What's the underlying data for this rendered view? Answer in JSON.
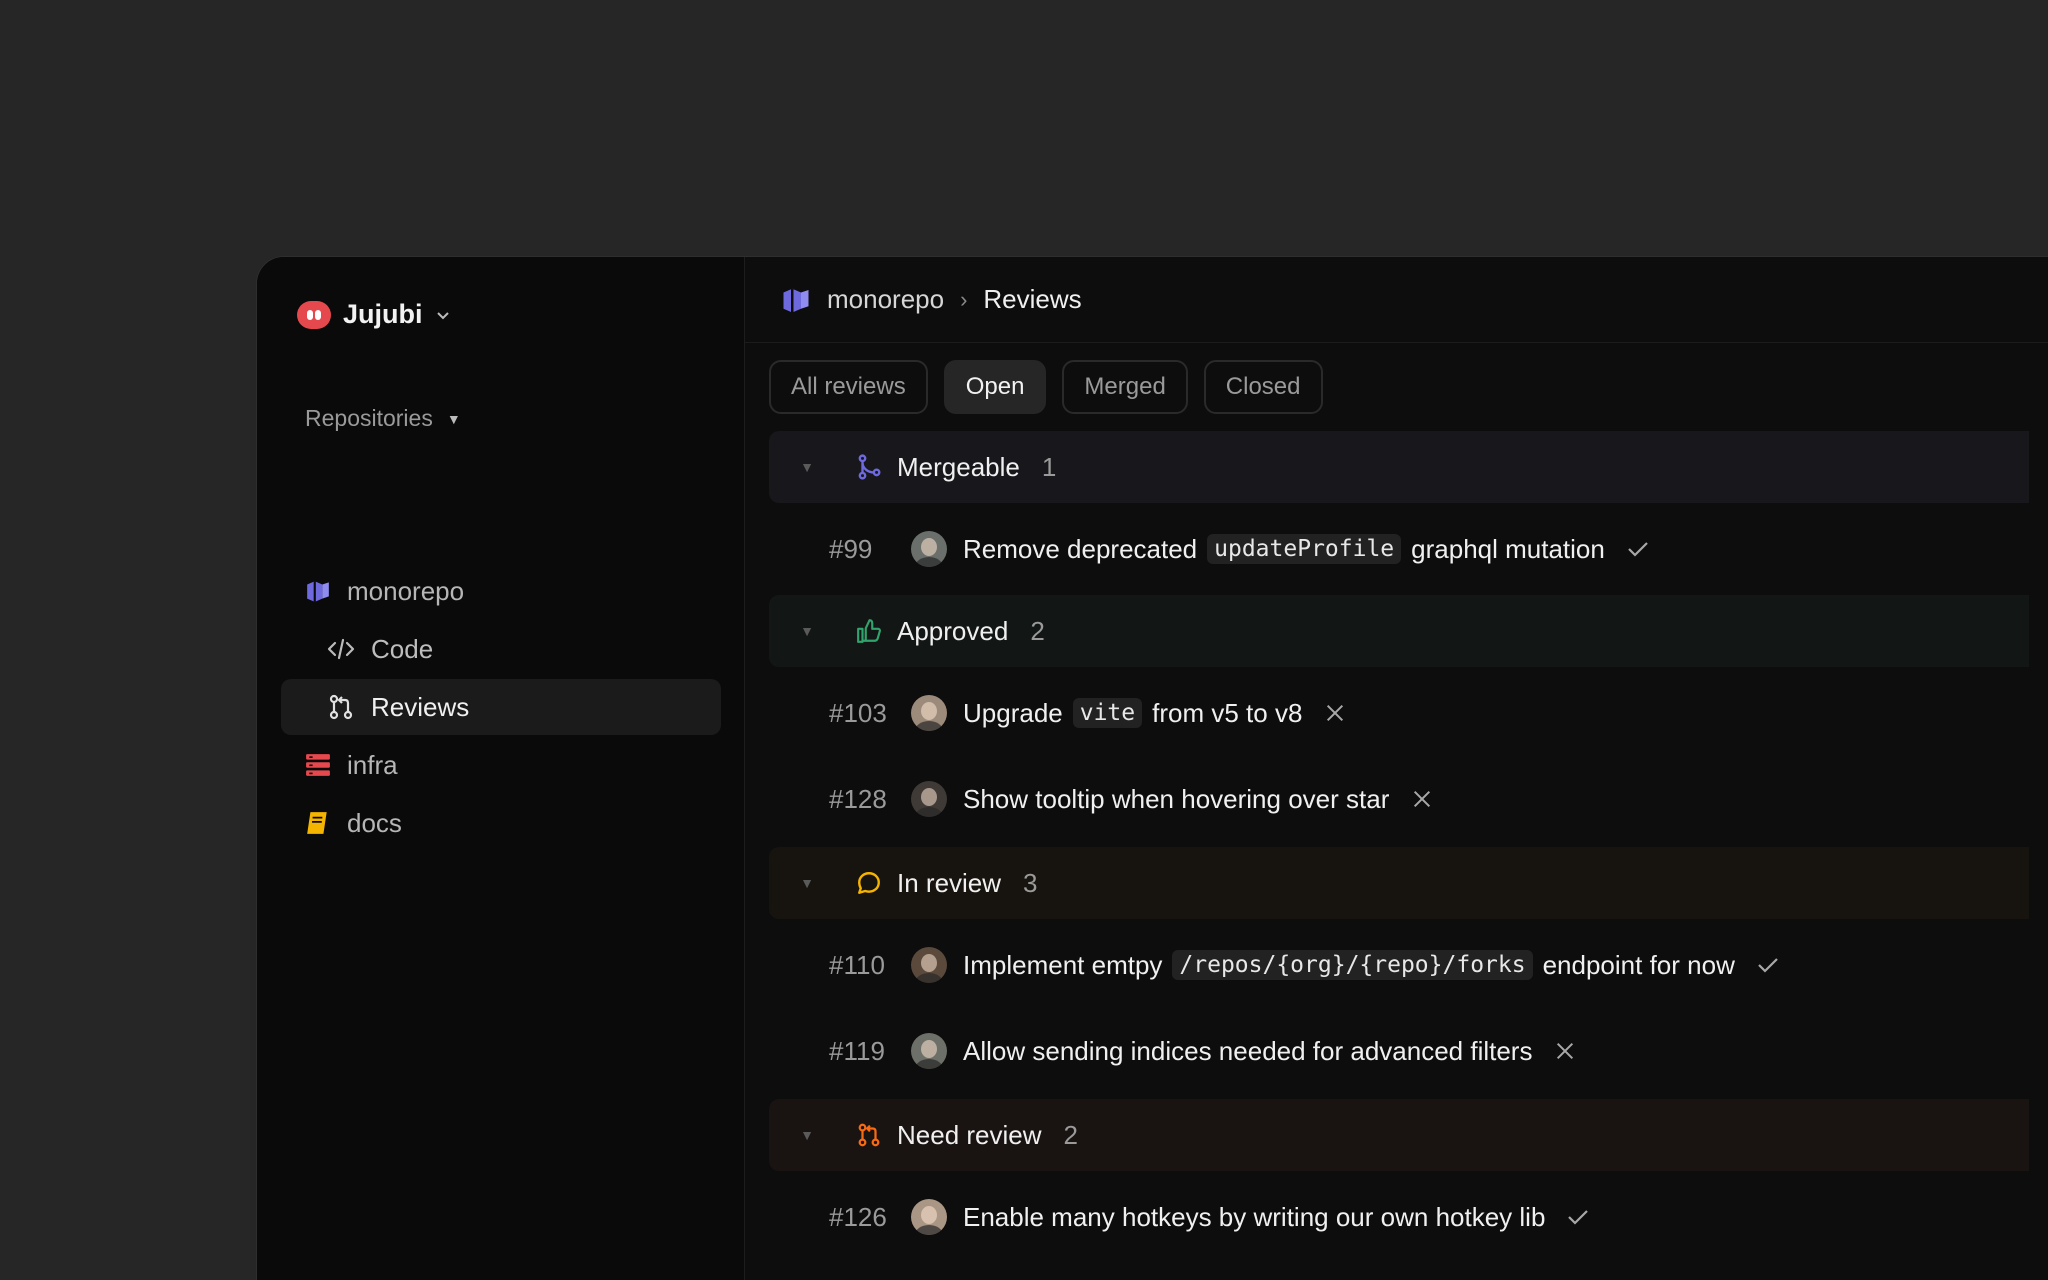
{
  "workspace": {
    "name": "Jujubi"
  },
  "sidebar": {
    "section_label": "Repositories",
    "repos": [
      {
        "name": "monorepo",
        "icon": "box-icon",
        "color": "#6e6ade"
      },
      {
        "name": "infra",
        "icon": "server-icon",
        "color": "#e5484d"
      },
      {
        "name": "docs",
        "icon": "book-icon",
        "color": "#f5b400"
      }
    ],
    "sub_items": [
      {
        "label": "Code",
        "icon": "code-icon"
      },
      {
        "label": "Reviews",
        "icon": "pull-request-icon",
        "active": true
      }
    ]
  },
  "breadcrumb": {
    "repo": "monorepo",
    "separator": "›",
    "current": "Reviews"
  },
  "tabs": [
    {
      "label": "All reviews"
    },
    {
      "label": "Open",
      "active": true
    },
    {
      "label": "Merged"
    },
    {
      "label": "Closed"
    }
  ],
  "groups": [
    {
      "name": "Mergeable",
      "count": "1",
      "icon": "merge-icon",
      "color": "#6e6ade",
      "items": [
        {
          "number": "#99",
          "pre": "Remove deprecated",
          "code": "updateProfile",
          "post": "graphql mutation",
          "status": "check"
        }
      ]
    },
    {
      "name": "Approved",
      "count": "2",
      "icon": "thumbs-up-icon",
      "color": "#30a46c",
      "items": [
        {
          "number": "#103",
          "pre": "Upgrade",
          "code": "vite",
          "post": "from v5 to v8",
          "status": "x"
        },
        {
          "number": "#128",
          "pre": "Show tooltip when hovering over star",
          "code": "",
          "post": "",
          "status": "x"
        }
      ]
    },
    {
      "name": "In review",
      "count": "3",
      "icon": "comment-icon",
      "color": "#f5b400",
      "items": [
        {
          "number": "#110",
          "pre": "Implement emtpy",
          "code": "/repos/{org}/{repo}/forks",
          "post": "endpoint for now",
          "status": "check"
        },
        {
          "number": "#119",
          "pre": "Allow sending indices needed for advanced filters",
          "code": "",
          "post": "",
          "status": "x"
        }
      ]
    },
    {
      "name": "Need review",
      "count": "2",
      "icon": "pull-request-icon",
      "color": "#f76b15",
      "items": [
        {
          "number": "#126",
          "pre": "Enable many hotkeys by writing our own hotkey lib",
          "code": "",
          "post": "",
          "status": "check"
        }
      ]
    }
  ]
}
